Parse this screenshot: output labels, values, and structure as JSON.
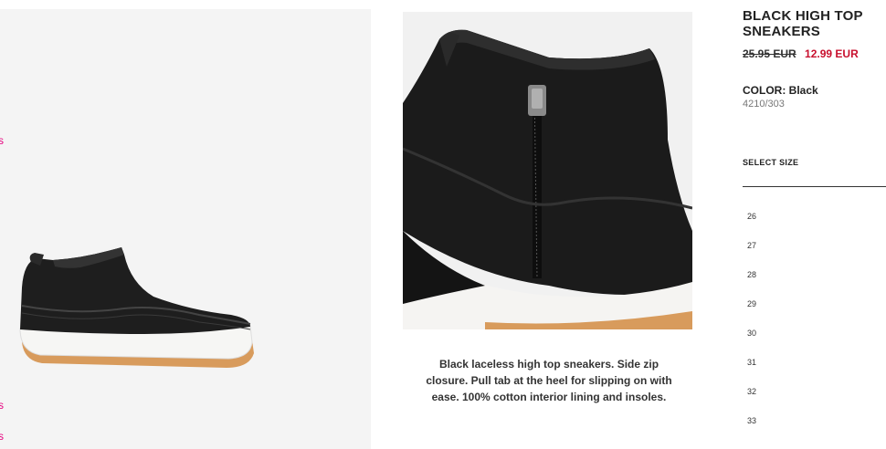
{
  "left_panel": {
    "links": [
      "s",
      "s",
      "s"
    ]
  },
  "product": {
    "title": "BLACK HIGH TOP SNEAKERS",
    "old_price": "25.95 EUR",
    "new_price": "12.99 EUR",
    "color_label": "COLOR: Black",
    "sku": "4210/303",
    "description": "Black laceless high top sneakers. Side zip closure. Pull tab at the heel for slipping on with ease. 100% cotton interior lining and insoles."
  },
  "size_selector": {
    "label": "SELECT SIZE",
    "sizes": [
      "26",
      "27",
      "28",
      "29",
      "30",
      "31",
      "32",
      "33"
    ]
  },
  "colors": {
    "sale_red": "#c8102e",
    "link_pink": "#e6007e",
    "panel_bg": "#f4f4f4"
  }
}
